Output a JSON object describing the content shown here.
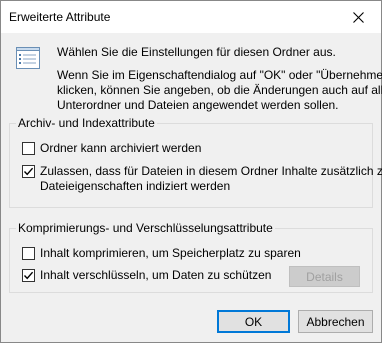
{
  "window": {
    "title": "Erweiterte Attribute"
  },
  "intro": {
    "line1": "Wählen Sie die Einstellungen für diesen Ordner aus.",
    "line2": "Wenn Sie im Eigenschaftendialog auf \"OK\" oder \"Übernehmen\"",
    "line3": "klicken, können Sie angeben, ob die Änderungen auch auf alle",
    "line4": "Unterordner und Dateien angewendet werden sollen."
  },
  "archive_group": {
    "title": "Archiv- und Indexattribute",
    "archive": {
      "label": "Ordner kann archiviert werden",
      "checked": false
    },
    "index": {
      "label_line1": "Zulassen, dass für Dateien in diesem Ordner Inhalte zusätzlich zu",
      "label_line2": "Dateieigenschaften indiziert werden",
      "checked": true
    }
  },
  "compress_group": {
    "title": "Komprimierungs- und Verschlüsselungsattribute",
    "compress": {
      "label": "Inhalt komprimieren, um Speicherplatz zu sparen",
      "checked": false
    },
    "encrypt": {
      "label": "Inhalt verschlüsseln, um Daten zu schützen",
      "checked": true
    },
    "details_label": "Details"
  },
  "buttons": {
    "ok": "OK",
    "cancel": "Abbrechen"
  },
  "colors": {
    "accent": "#0078d7",
    "dialog_bg": "#f0f0f0",
    "titlebar_bg": "#ffffff"
  }
}
